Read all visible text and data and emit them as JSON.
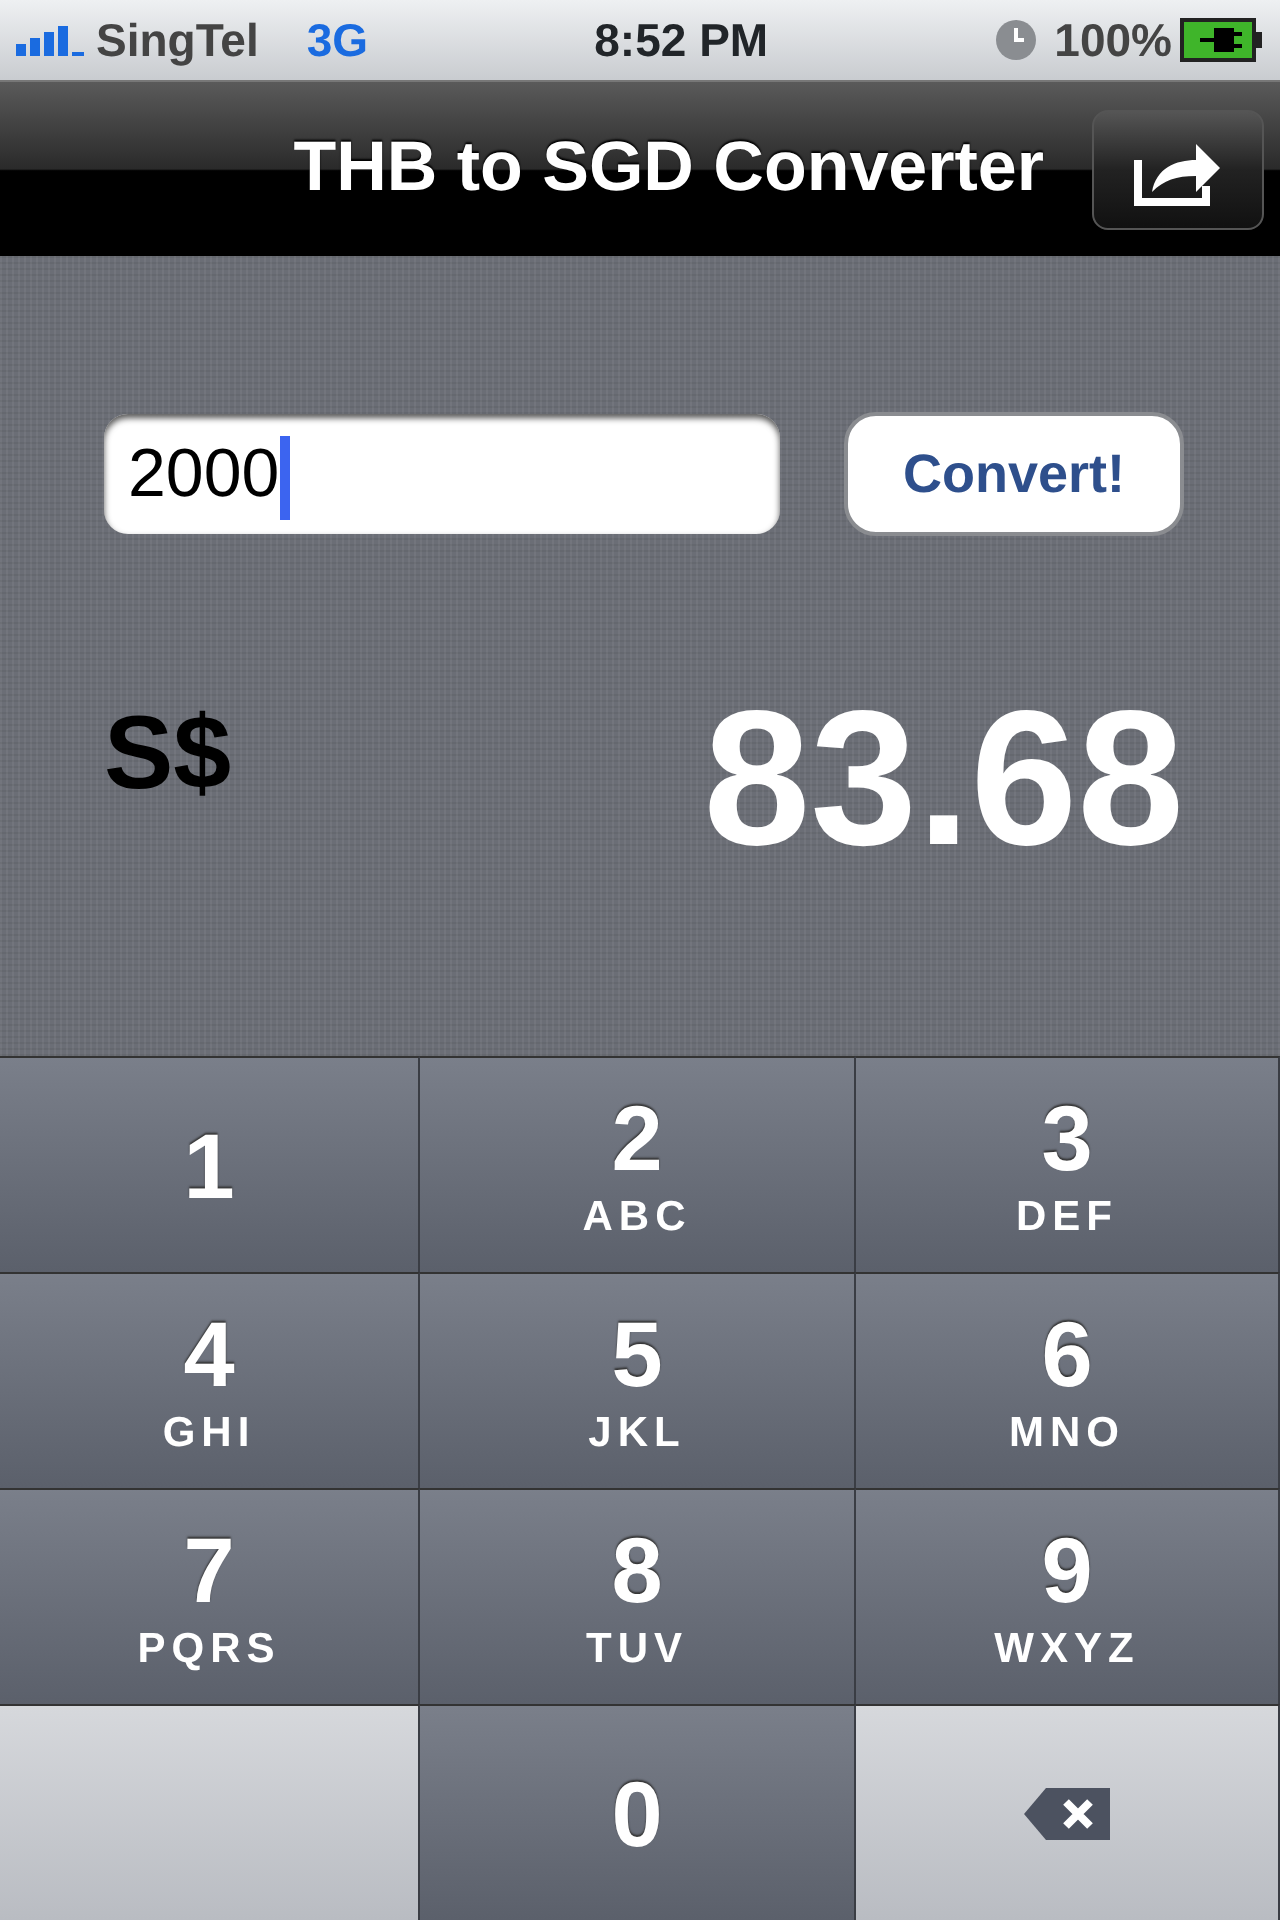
{
  "status_bar": {
    "carrier": "SingTel",
    "network": "3G",
    "time": "8:52 PM",
    "battery": "100%"
  },
  "nav_bar": {
    "title": "THB to SGD Converter"
  },
  "amount_field": {
    "value": "2000"
  },
  "convert_button": {
    "label": "Convert!"
  },
  "result": {
    "currency": "S$",
    "amount": "83.68"
  },
  "keypad": [
    {
      "kind": "digit",
      "digit": "1"
    },
    {
      "kind": "digit",
      "digit": "2",
      "letters": "ABC"
    },
    {
      "kind": "digit",
      "digit": "3",
      "letters": "DEF"
    },
    {
      "kind": "digit",
      "digit": "4",
      "letters": "GHI"
    },
    {
      "kind": "digit",
      "digit": "5",
      "letters": "JKL"
    },
    {
      "kind": "digit",
      "digit": "6",
      "letters": "MNO"
    },
    {
      "kind": "digit",
      "digit": "7",
      "letters": "PQRS"
    },
    {
      "kind": "digit",
      "digit": "8",
      "letters": "TUV"
    },
    {
      "kind": "digit",
      "digit": "9",
      "letters": "WXYZ"
    },
    {
      "kind": "blank"
    },
    {
      "kind": "digit",
      "digit": "0"
    },
    {
      "kind": "delete"
    }
  ]
}
